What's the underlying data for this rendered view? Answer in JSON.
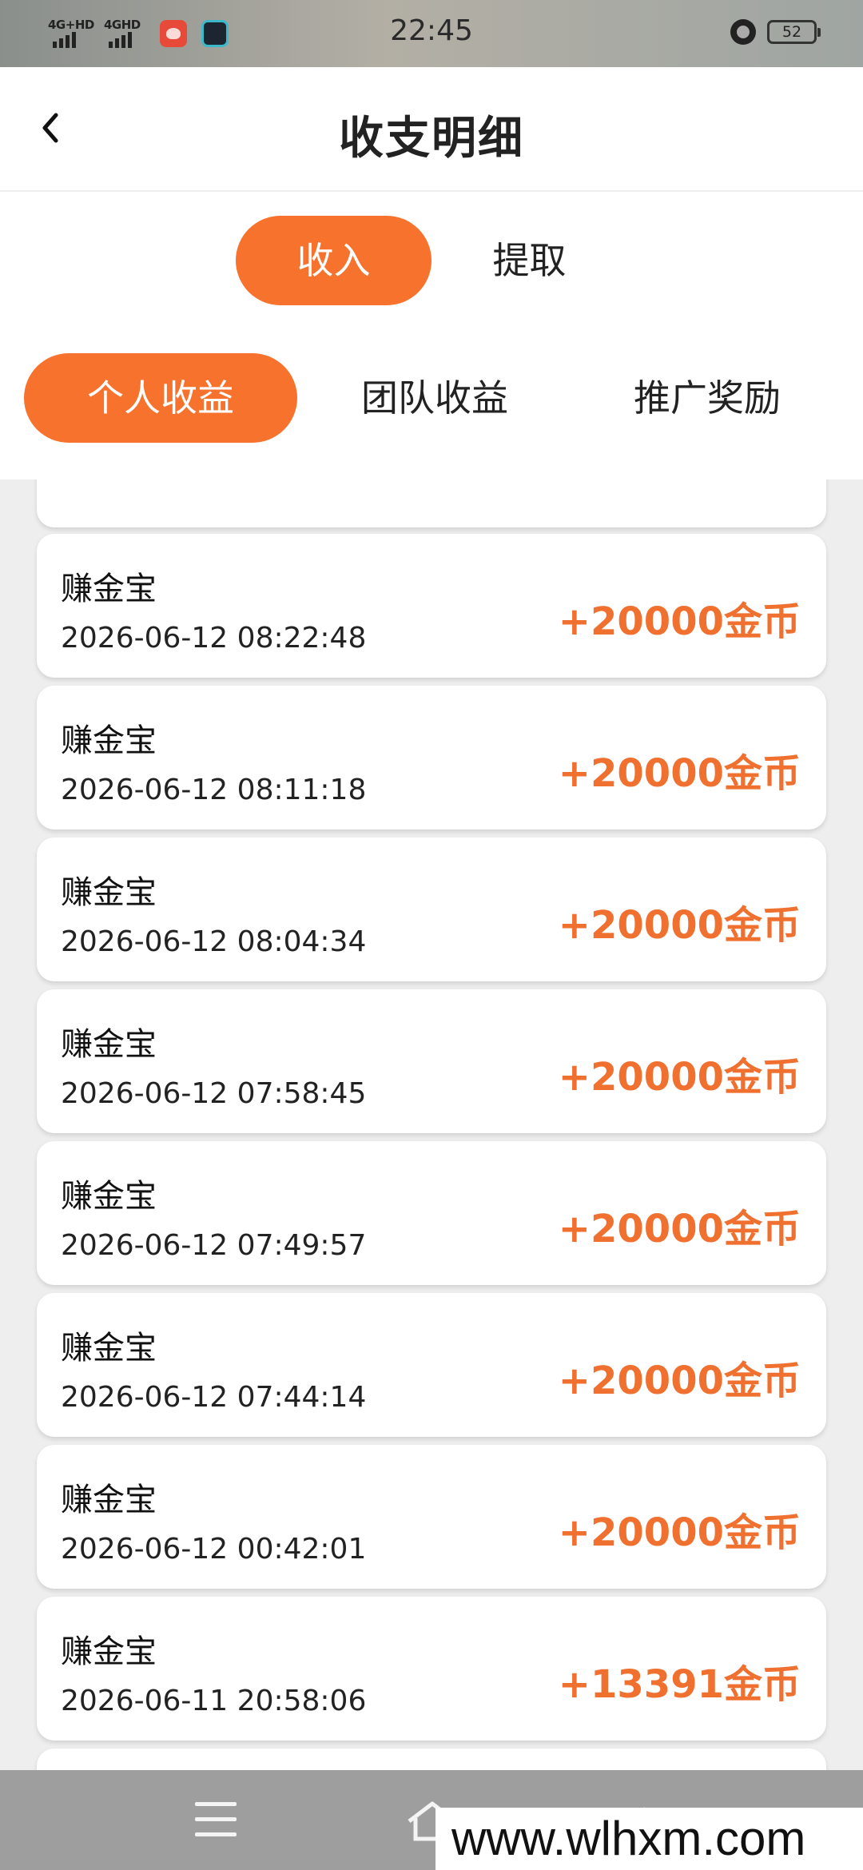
{
  "status_bar": {
    "signal_1": "4G+HD",
    "signal_2": "4GHD",
    "time": "22:45",
    "battery": "52"
  },
  "header": {
    "title": "收支明细",
    "back_icon": "chevron-left-icon"
  },
  "tabs": [
    {
      "label": "收入",
      "active": true
    },
    {
      "label": "提取",
      "active": false
    }
  ],
  "sub_tabs": [
    {
      "label": "个人收益",
      "active": true
    },
    {
      "label": "团队收益",
      "active": false
    },
    {
      "label": "推广奖励",
      "active": false
    }
  ],
  "records": [
    {
      "name": "赚金宝",
      "time": "2026-06-12 08:22:48",
      "amount": "+20000金币"
    },
    {
      "name": "赚金宝",
      "time": "2026-06-12 08:11:18",
      "amount": "+20000金币"
    },
    {
      "name": "赚金宝",
      "time": "2026-06-12 08:04:34",
      "amount": "+20000金币"
    },
    {
      "name": "赚金宝",
      "time": "2026-06-12 07:58:45",
      "amount": "+20000金币"
    },
    {
      "name": "赚金宝",
      "time": "2026-06-12 07:49:57",
      "amount": "+20000金币"
    },
    {
      "name": "赚金宝",
      "time": "2026-06-12 07:44:14",
      "amount": "+20000金币"
    },
    {
      "name": "赚金宝",
      "time": "2026-06-12 00:42:01",
      "amount": "+20000金币"
    },
    {
      "name": "赚金宝",
      "time": "2026-06-11 20:58:06",
      "amount": "+13391金币"
    }
  ],
  "nav": {
    "menu_icon": "menu-icon",
    "home_icon": "home-icon",
    "back_icon": "back-icon"
  },
  "watermark": "www.wlhxm.com",
  "colors": {
    "accent": "#f7722c",
    "amount": "#f07030"
  }
}
